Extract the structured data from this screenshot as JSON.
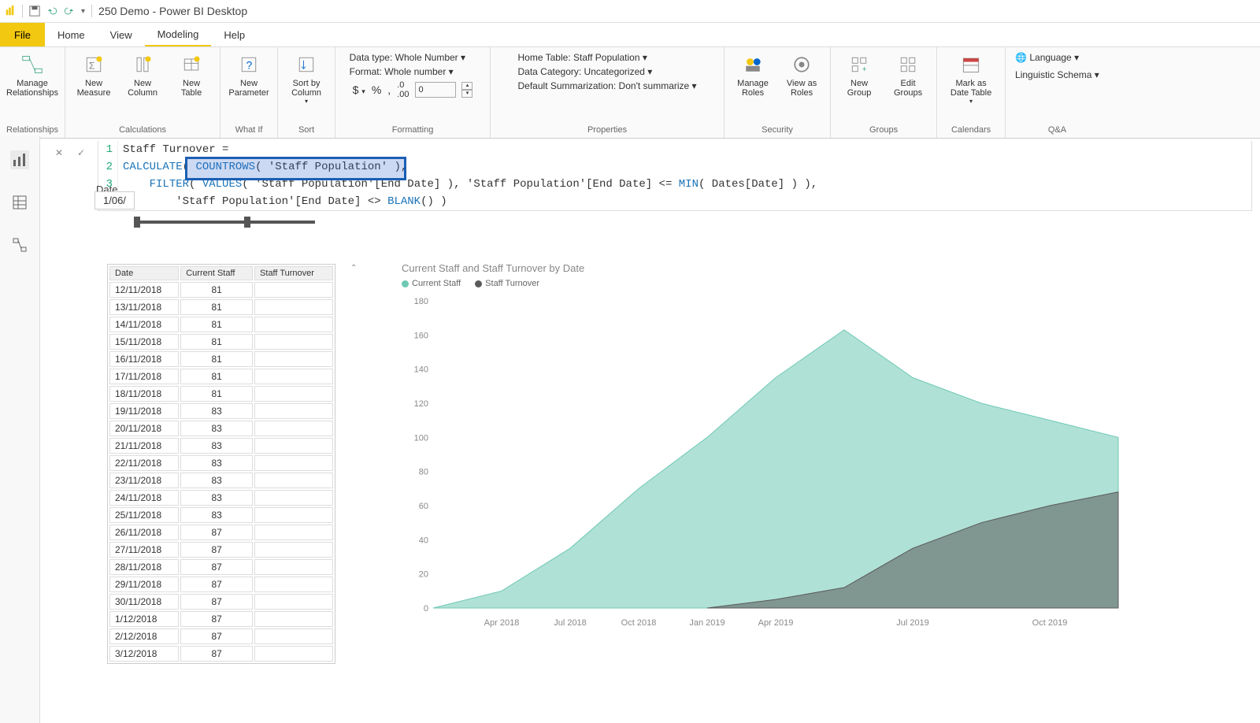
{
  "window": {
    "title": "250 Demo - Power BI Desktop"
  },
  "menubar": {
    "file": "File",
    "tabs": [
      "Home",
      "View",
      "Modeling",
      "Help"
    ],
    "active": "Modeling"
  },
  "ribbon": {
    "relationships": {
      "label": "Relationships",
      "manage": "Manage\nRelationships"
    },
    "calculations": {
      "label": "Calculations",
      "newMeasure": "New\nMeasure",
      "newColumn": "New\nColumn",
      "newTable": "New\nTable"
    },
    "whatif": {
      "label": "What If",
      "newParameter": "New\nParameter"
    },
    "sort": {
      "label": "Sort",
      "sortBy": "Sort by\nColumn"
    },
    "formatting": {
      "label": "Formatting",
      "dataType": "Data type: Whole Number",
      "format": "Format: Whole number",
      "decimals": "0"
    },
    "properties": {
      "label": "Properties",
      "homeTable": "Home Table: Staff Population",
      "dataCategory": "Data Category: Uncategorized",
      "summarization": "Default Summarization: Don't summarize"
    },
    "security": {
      "label": "Security",
      "manageRoles": "Manage\nRoles",
      "viewAs": "View as\nRoles"
    },
    "groups": {
      "label": "Groups",
      "newGroup": "New\nGroup",
      "editGroups": "Edit\nGroups"
    },
    "calendars": {
      "label": "Calendars",
      "markAs": "Mark as\nDate Table"
    },
    "qa": {
      "label": "Q&A",
      "language": "Language",
      "schema": "Linguistic Schema"
    }
  },
  "formula": {
    "line1": "Staff Turnover =",
    "line2_calc": "CALCULATE",
    "line2_countrows": "COUNTROWS",
    "line2_arg": "( 'Staff Population' ),",
    "line3_filter": "FILTER",
    "line3_values": "VALUES",
    "line3_rest": "( 'Staff Population'[End Date] ), 'Staff Population'[End Date] <= ",
    "line3_min": "MIN",
    "line3_tail": "( Dates[Date] ) ),",
    "line4_pre": "'Staff Population'[End Date] <> ",
    "line4_blank": "BLANK",
    "line4_tail": "() )"
  },
  "dateLabel": "Date",
  "dateValue": "1/06/",
  "table": {
    "headers": [
      "Date",
      "Current Staff",
      "Staff Turnover"
    ],
    "rows": [
      [
        "12/11/2018",
        "81",
        ""
      ],
      [
        "13/11/2018",
        "81",
        ""
      ],
      [
        "14/11/2018",
        "81",
        ""
      ],
      [
        "15/11/2018",
        "81",
        ""
      ],
      [
        "16/11/2018",
        "81",
        ""
      ],
      [
        "17/11/2018",
        "81",
        ""
      ],
      [
        "18/11/2018",
        "81",
        ""
      ],
      [
        "19/11/2018",
        "83",
        ""
      ],
      [
        "20/11/2018",
        "83",
        ""
      ],
      [
        "21/11/2018",
        "83",
        ""
      ],
      [
        "22/11/2018",
        "83",
        ""
      ],
      [
        "23/11/2018",
        "83",
        ""
      ],
      [
        "24/11/2018",
        "83",
        ""
      ],
      [
        "25/11/2018",
        "83",
        ""
      ],
      [
        "26/11/2018",
        "87",
        ""
      ],
      [
        "27/11/2018",
        "87",
        ""
      ],
      [
        "28/11/2018",
        "87",
        ""
      ],
      [
        "29/11/2018",
        "87",
        ""
      ],
      [
        "30/11/2018",
        "87",
        ""
      ],
      [
        "1/12/2018",
        "87",
        ""
      ],
      [
        "2/12/2018",
        "87",
        ""
      ],
      [
        "3/12/2018",
        "87",
        ""
      ]
    ]
  },
  "chart_data": {
    "type": "area",
    "title": "Current Staff and Staff Turnover by Date",
    "ylabel": "",
    "xlabel": "",
    "ylim": [
      0,
      180
    ],
    "yticks": [
      0,
      20,
      40,
      60,
      80,
      100,
      120,
      140,
      160,
      180
    ],
    "xticks": [
      "Apr 2018",
      "Jul 2018",
      "Oct 2018",
      "Jan 2019",
      "Apr 2019",
      "Jul 2019",
      "Oct 2019"
    ],
    "legend": [
      "Current Staff",
      "Staff Turnover"
    ],
    "colors": {
      "Current Staff": "#6fc9b4",
      "Staff Turnover": "#5a5a5a"
    },
    "series": [
      {
        "name": "Current Staff",
        "x": [
          "Feb 2018",
          "Apr 2018",
          "Jul 2018",
          "Oct 2018",
          "Jan 2019",
          "Apr 2019",
          "Jun 2019",
          "Jul 2019",
          "Aug 2019",
          "Oct 2019",
          "Dec 2019"
        ],
        "values": [
          0,
          10,
          35,
          70,
          100,
          135,
          163,
          135,
          120,
          110,
          100
        ]
      },
      {
        "name": "Staff Turnover",
        "x": [
          "Jan 2019",
          "Apr 2019",
          "Jun 2019",
          "Jul 2019",
          "Aug 2019",
          "Oct 2019",
          "Dec 2019"
        ],
        "values": [
          0,
          5,
          12,
          35,
          50,
          60,
          68
        ]
      }
    ]
  }
}
